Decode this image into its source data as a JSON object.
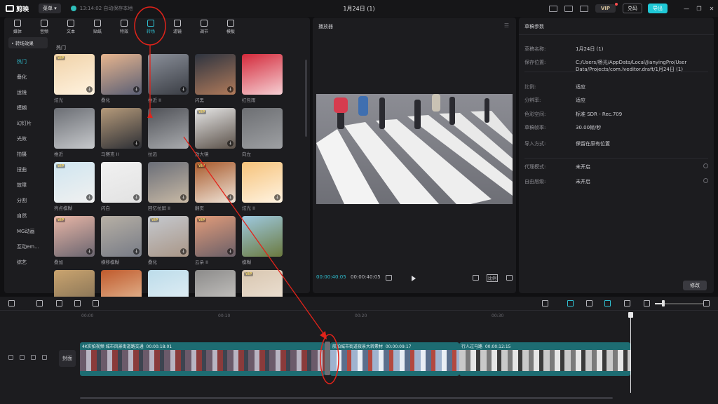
{
  "app": {
    "name": "剪映",
    "menu_label": "菜单",
    "autosave": "13:14:02 自动保存本地",
    "title": "1月24日 (1)",
    "vip_label": "VIP",
    "redeem_label": "兑码",
    "export_label": "导出"
  },
  "toolbar": {
    "items": [
      {
        "label": "媒体",
        "icon": "media-icon"
      },
      {
        "label": "音频",
        "icon": "audio-icon"
      },
      {
        "label": "文本",
        "icon": "text-icon"
      },
      {
        "label": "贴纸",
        "icon": "sticker-icon"
      },
      {
        "label": "特效",
        "icon": "effects-icon"
      },
      {
        "label": "转场",
        "icon": "transition-icon",
        "active": true
      },
      {
        "label": "滤镜",
        "icon": "filter-icon"
      },
      {
        "label": "调节",
        "icon": "adjust-icon"
      },
      {
        "label": "模板",
        "icon": "template-icon"
      }
    ]
  },
  "sidebar": {
    "filter_label": "• 转场效果",
    "items": [
      "热门",
      "叠化",
      "运镜",
      "模糊",
      "幻灯片",
      "光效",
      "拍摄",
      "扭曲",
      "故障",
      "分割",
      "自然",
      "MG动画",
      "互动em...",
      "综艺"
    ],
    "active_index": 0
  },
  "library": {
    "section_title": "热门",
    "cards": [
      {
        "label": "炫光",
        "vip": true,
        "download": true,
        "colors": [
          "#f0d2a8",
          "#fff3e0"
        ]
      },
      {
        "label": "叠化",
        "vip": false,
        "download": true,
        "colors": [
          "#e7b58e",
          "#5a5f75"
        ]
      },
      {
        "label": "推近 II",
        "vip": false,
        "download": true,
        "colors": [
          "#8a8f99",
          "#3a3d44"
        ]
      },
      {
        "label": "闪黑",
        "vip": false,
        "download": true,
        "colors": [
          "#2e3440",
          "#b07a5a"
        ]
      },
      {
        "label": "红包雨",
        "vip": false,
        "download": false,
        "colors": [
          "#d3293a",
          "#f6d0d4"
        ]
      },
      {
        "label": "推近",
        "vip": false,
        "download": false,
        "colors": [
          "#6b6e74",
          "#c7c9cc"
        ]
      },
      {
        "label": "马赛克 II",
        "vip": false,
        "download": true,
        "colors": [
          "#b59a7a",
          "#2d2f35"
        ]
      },
      {
        "label": "拉远",
        "vip": false,
        "download": false,
        "colors": [
          "#505258",
          "#a9abae"
        ]
      },
      {
        "label": "放大镜",
        "vip": true,
        "download": true,
        "colors": [
          "#e6e6e6",
          "#5a5048"
        ]
      },
      {
        "label": "向左",
        "vip": false,
        "download": false,
        "colors": [
          "#6d6f73",
          "#9ea0a3"
        ]
      },
      {
        "label": "亮点模糊",
        "vip": true,
        "download": true,
        "colors": [
          "#cfe5ef",
          "#f1f1f1"
        ]
      },
      {
        "label": "闪白",
        "vip": false,
        "download": true,
        "colors": [
          "#f1f1f1",
          "#e2e2e2"
        ]
      },
      {
        "label": "回忆拉屏 II",
        "vip": false,
        "download": true,
        "colors": [
          "#6a6e78",
          "#c8b9a5"
        ]
      },
      {
        "label": "翻页",
        "vip": true,
        "download": true,
        "colors": [
          "#a85a2c",
          "#efe4d8"
        ]
      },
      {
        "label": "炫光 II",
        "vip": false,
        "download": true,
        "colors": [
          "#f6c27a",
          "#fff4e2"
        ]
      },
      {
        "label": "叠加",
        "vip": true,
        "download": true,
        "colors": [
          "#e8b6a6",
          "#6a6570"
        ]
      },
      {
        "label": "横移模糊",
        "vip": false,
        "download": true,
        "colors": [
          "#b7b0a5",
          "#777b86"
        ]
      },
      {
        "label": "叠化",
        "vip": true,
        "download": true,
        "colors": [
          "#c5c9cf",
          "#a99687"
        ]
      },
      {
        "label": "云朵 II",
        "vip": true,
        "download": true,
        "colors": [
          "#e29c7a",
          "#6a5f68"
        ]
      },
      {
        "label": "模糊",
        "vip": false,
        "download": false,
        "colors": [
          "#9ec9e0",
          "#6b7a3f"
        ]
      },
      {
        "label": "",
        "vip": false,
        "download": false,
        "colors": [
          "#caa46f",
          "#7a6a52"
        ]
      },
      {
        "label": "",
        "vip": false,
        "download": false,
        "colors": [
          "#c05a2c",
          "#e9c7a4"
        ]
      },
      {
        "label": "",
        "vip": false,
        "download": false,
        "colors": [
          "#bcdcea",
          "#e8f1f6"
        ]
      },
      {
        "label": "",
        "vip": false,
        "download": false,
        "colors": [
          "#8c8b8a",
          "#cfcdca"
        ]
      },
      {
        "label": "",
        "vip": true,
        "download": false,
        "colors": [
          "#d8c6b0",
          "#f0e6da"
        ]
      }
    ]
  },
  "player": {
    "title": "播放器",
    "current_time": "00:00:40:05",
    "total_time": "00:00:40:05",
    "ratio_label": "比例"
  },
  "props": {
    "title": "草稿参数",
    "rows": [
      {
        "key": "草稿名称:",
        "value": "1月24日 (1)"
      },
      {
        "key": "保存位置:",
        "value": "C:/Users/杨光/AppData/Local/JianyingPro/User Data/Projects/com.lveditor.draft/1月24日 (1)"
      },
      {
        "key": "比例:",
        "value": "适应"
      },
      {
        "key": "分辨率:",
        "value": "适应"
      },
      {
        "key": "色彩空间:",
        "value": "标准 SDR - Rec.709"
      },
      {
        "key": "草稿帧率:",
        "value": "30.00帧/秒"
      },
      {
        "key": "导入方式:",
        "value": "保留在原有位置"
      },
      {
        "key": "代理模式:",
        "value": "未开启"
      },
      {
        "key": "自由层级:",
        "value": "未开启"
      }
    ],
    "modify_label": "修改"
  },
  "timeline": {
    "ticks": [
      "00:00",
      "00:10",
      "00:20",
      "00:30"
    ],
    "cover_label": "封面",
    "clips": [
      {
        "label": "4K实拍视频 城市风景街道路交通",
        "duration": "00:00:18:01",
        "color": "#1d6c72"
      },
      {
        "label": "航拍城市街道夜景大转素材",
        "duration": "00:00:09:17",
        "color": "#1d6c72"
      },
      {
        "label": "行人过马路",
        "duration": "00:00:12:15",
        "color": "#1d6c72"
      }
    ]
  },
  "annotation": {
    "color": "#e2231a"
  }
}
